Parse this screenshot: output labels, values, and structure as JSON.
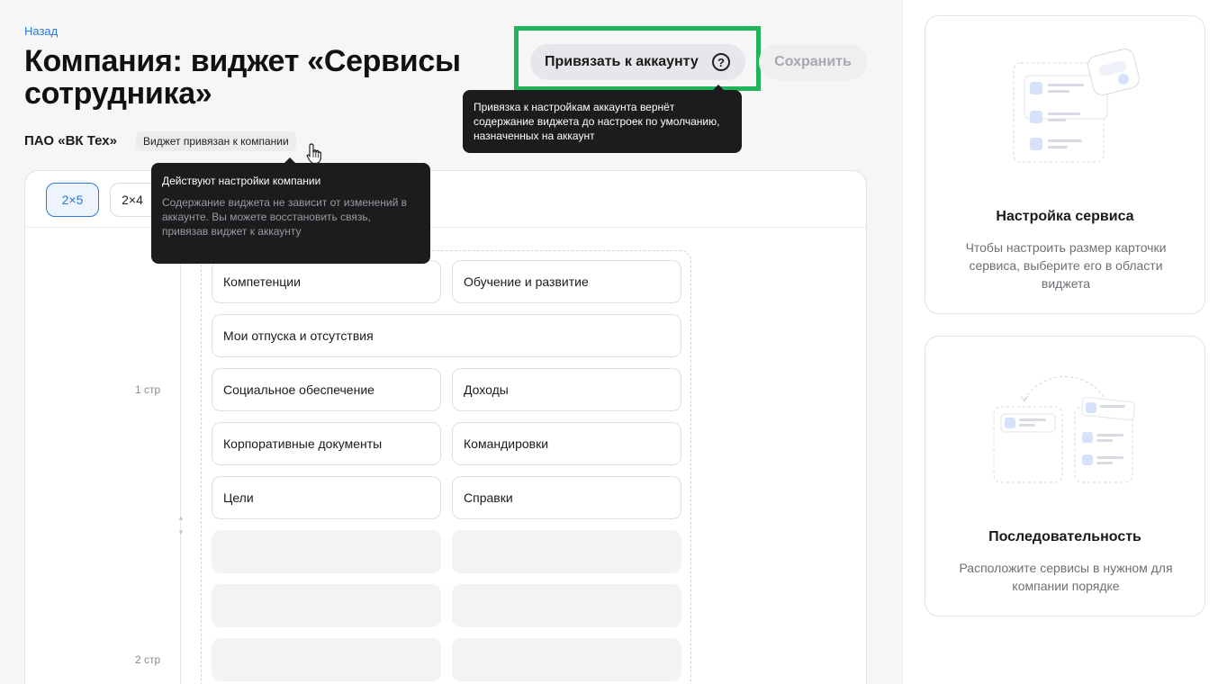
{
  "header": {
    "back_label": "Назад",
    "title": "Компания: виджет «Сервисы сотрудника»",
    "link_button_label": "Привязать к аккаунту",
    "link_help_glyph": "?",
    "save_button_label": "Сохранить"
  },
  "link_tooltip": {
    "text": "Привязка к настройкам аккаунта вернёт содержание виджета до настроек по умолчанию, назначенных на аккаунт"
  },
  "company": {
    "name": "ПАО «ВК Тех»",
    "badge": "Виджет привязан к компании"
  },
  "company_tooltip": {
    "title": "Действуют настройки компании",
    "body": "Содержание виджета не зависит от изменений в аккаунте. Вы можете восстановить связь, привязав виджет к аккаунту"
  },
  "size_options": [
    {
      "label": "2×5",
      "selected": true
    },
    {
      "label": "2×4",
      "selected": false
    }
  ],
  "pages": {
    "page1_label": "1 стр",
    "page2_label": "2 стр"
  },
  "services": {
    "s1": "Компетенции",
    "s2": "Обучение и развитие",
    "s3": "Мои отпуска и отсутствия",
    "s4": "Социальное обеспечение",
    "s5": "Доходы",
    "s6": "Корпоративные документы",
    "s7": "Командировки",
    "s8": "Цели",
    "s9": "Справки"
  },
  "side_cards": {
    "service_setup": {
      "title": "Настройка сервиса",
      "text": "Чтобы настроить размер карточки сервиса, выберите его в области виджета"
    },
    "sequence": {
      "title": "Последовательность",
      "text": "Расположите сервисы в нужном для компании порядке"
    }
  },
  "colors": {
    "accent": "#2b7ad6",
    "highlight": "#21b45b",
    "tooltip_bg": "#1c1c1e"
  },
  "icons": [
    "question-circle-icon",
    "hand-pointer-icon",
    "service-setup-illustration",
    "sequence-illustration"
  ]
}
